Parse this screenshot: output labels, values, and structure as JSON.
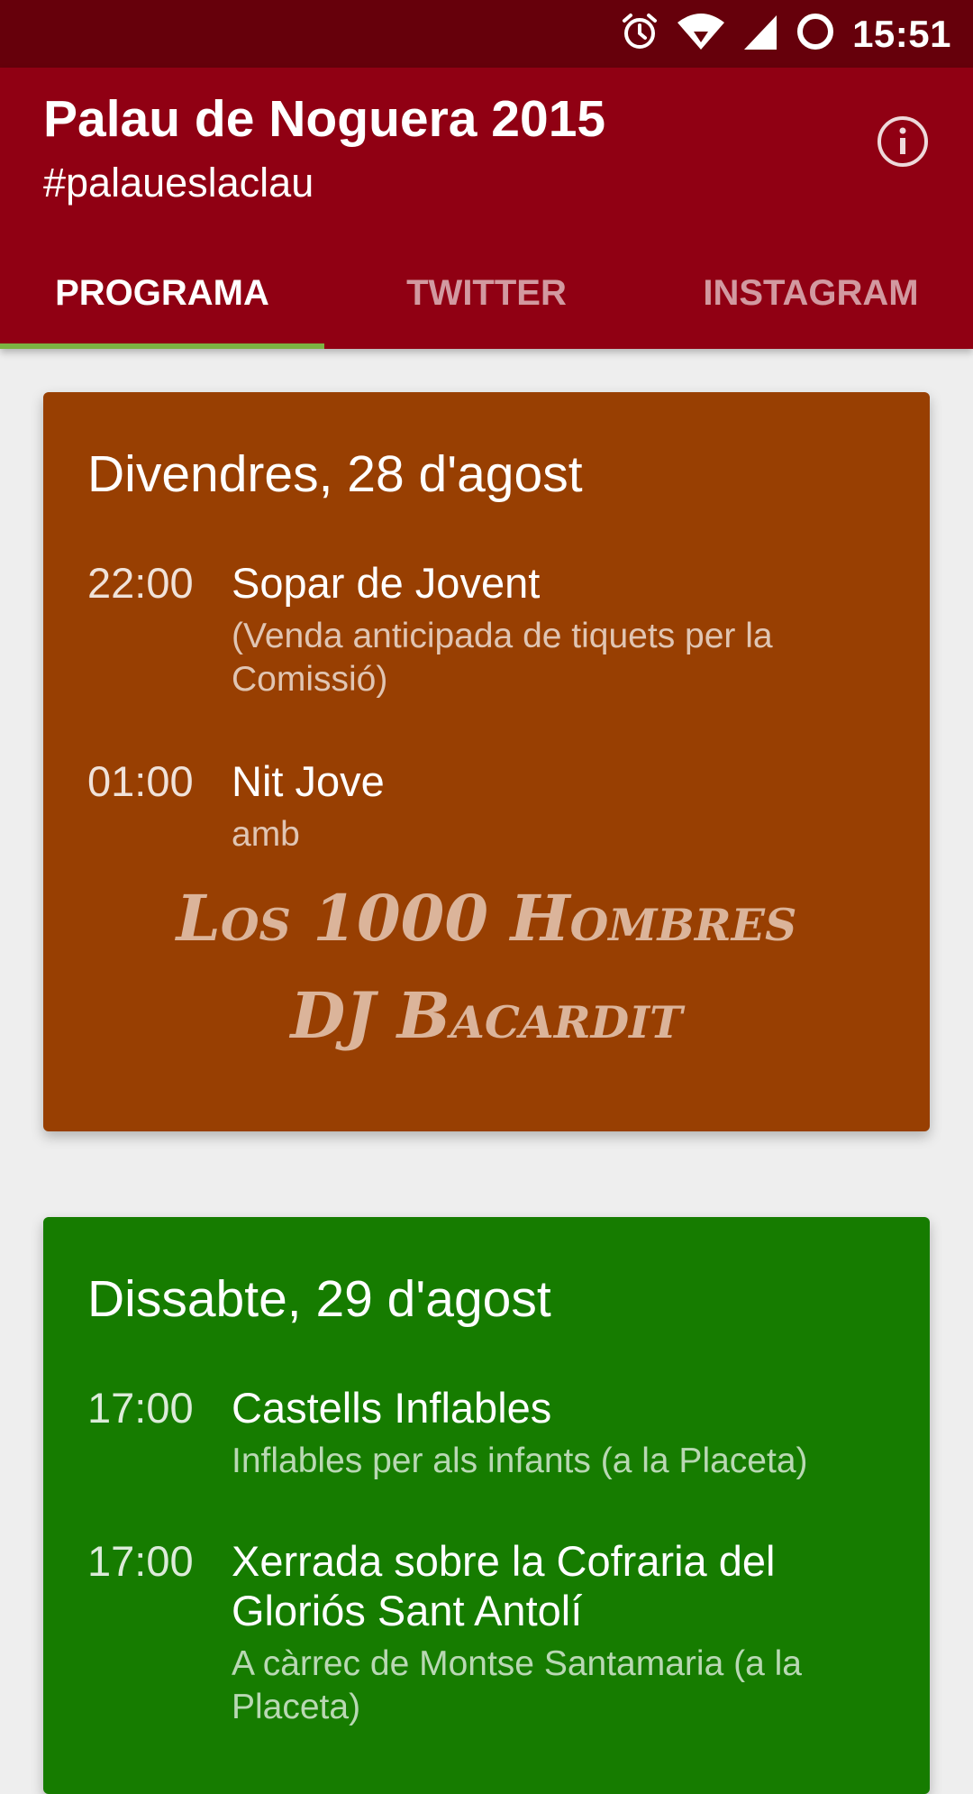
{
  "status_bar": {
    "time": "15:51",
    "icons": [
      "alarm-icon",
      "wifi-icon",
      "signal-icon",
      "sync-icon"
    ]
  },
  "app_bar": {
    "title": "Palau de Noguera 2015",
    "subtitle": "#palaueslaclau",
    "info_icon": "info-icon"
  },
  "tabs": [
    {
      "label": "PROGRAMA",
      "active": true
    },
    {
      "label": "TWITTER",
      "active": false
    },
    {
      "label": "INSTAGRAM",
      "active": false
    }
  ],
  "days": [
    {
      "title": "Divendres, 28 d'agost",
      "color": "#983f02",
      "events": [
        {
          "time": "22:00",
          "title": "Sopar de Jovent",
          "desc": "(Venda anticipada de tiquets per la Comissió)"
        },
        {
          "time": "01:00",
          "title": "Nit Jove",
          "desc": "amb"
        }
      ],
      "headliners": [
        "Los 1000 Hombres",
        "DJ Bacardit"
      ]
    },
    {
      "title": "Dissabte, 29 d'agost",
      "color": "#167c00",
      "events": [
        {
          "time": "17:00",
          "title": "Castells Inflables",
          "desc": "Inflables per als infants (a la Placeta)"
        },
        {
          "time": "17:00",
          "title": "Xerrada sobre la Cofraria del Gloriós Sant Antolí",
          "desc": "A càrrec de Montse Santamaria (a la Placeta)"
        }
      ]
    }
  ],
  "colors": {
    "app_bar": "#900013",
    "status_bar": "#66000b",
    "tab_indicator": "#7cb342",
    "background": "#eeeeee"
  }
}
